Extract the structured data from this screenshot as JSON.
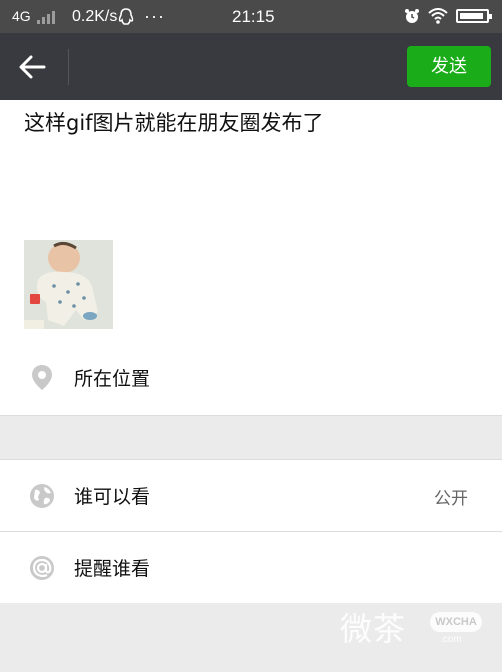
{
  "status_bar": {
    "network": "4G",
    "speed": "0.2K/s",
    "more": "···",
    "time": "21:15",
    "battery_level": 0.9
  },
  "title_bar": {
    "send_label": "发送"
  },
  "post": {
    "text": "这样gif图片就能在朋友圈发布了"
  },
  "options": {
    "location_label": "所在位置",
    "visibility_label": "谁可以看",
    "visibility_value": "公开",
    "mention_label": "提醒谁看"
  },
  "watermark": {
    "text": "微茶",
    "badge": "WXCHA",
    "url": ".com"
  }
}
